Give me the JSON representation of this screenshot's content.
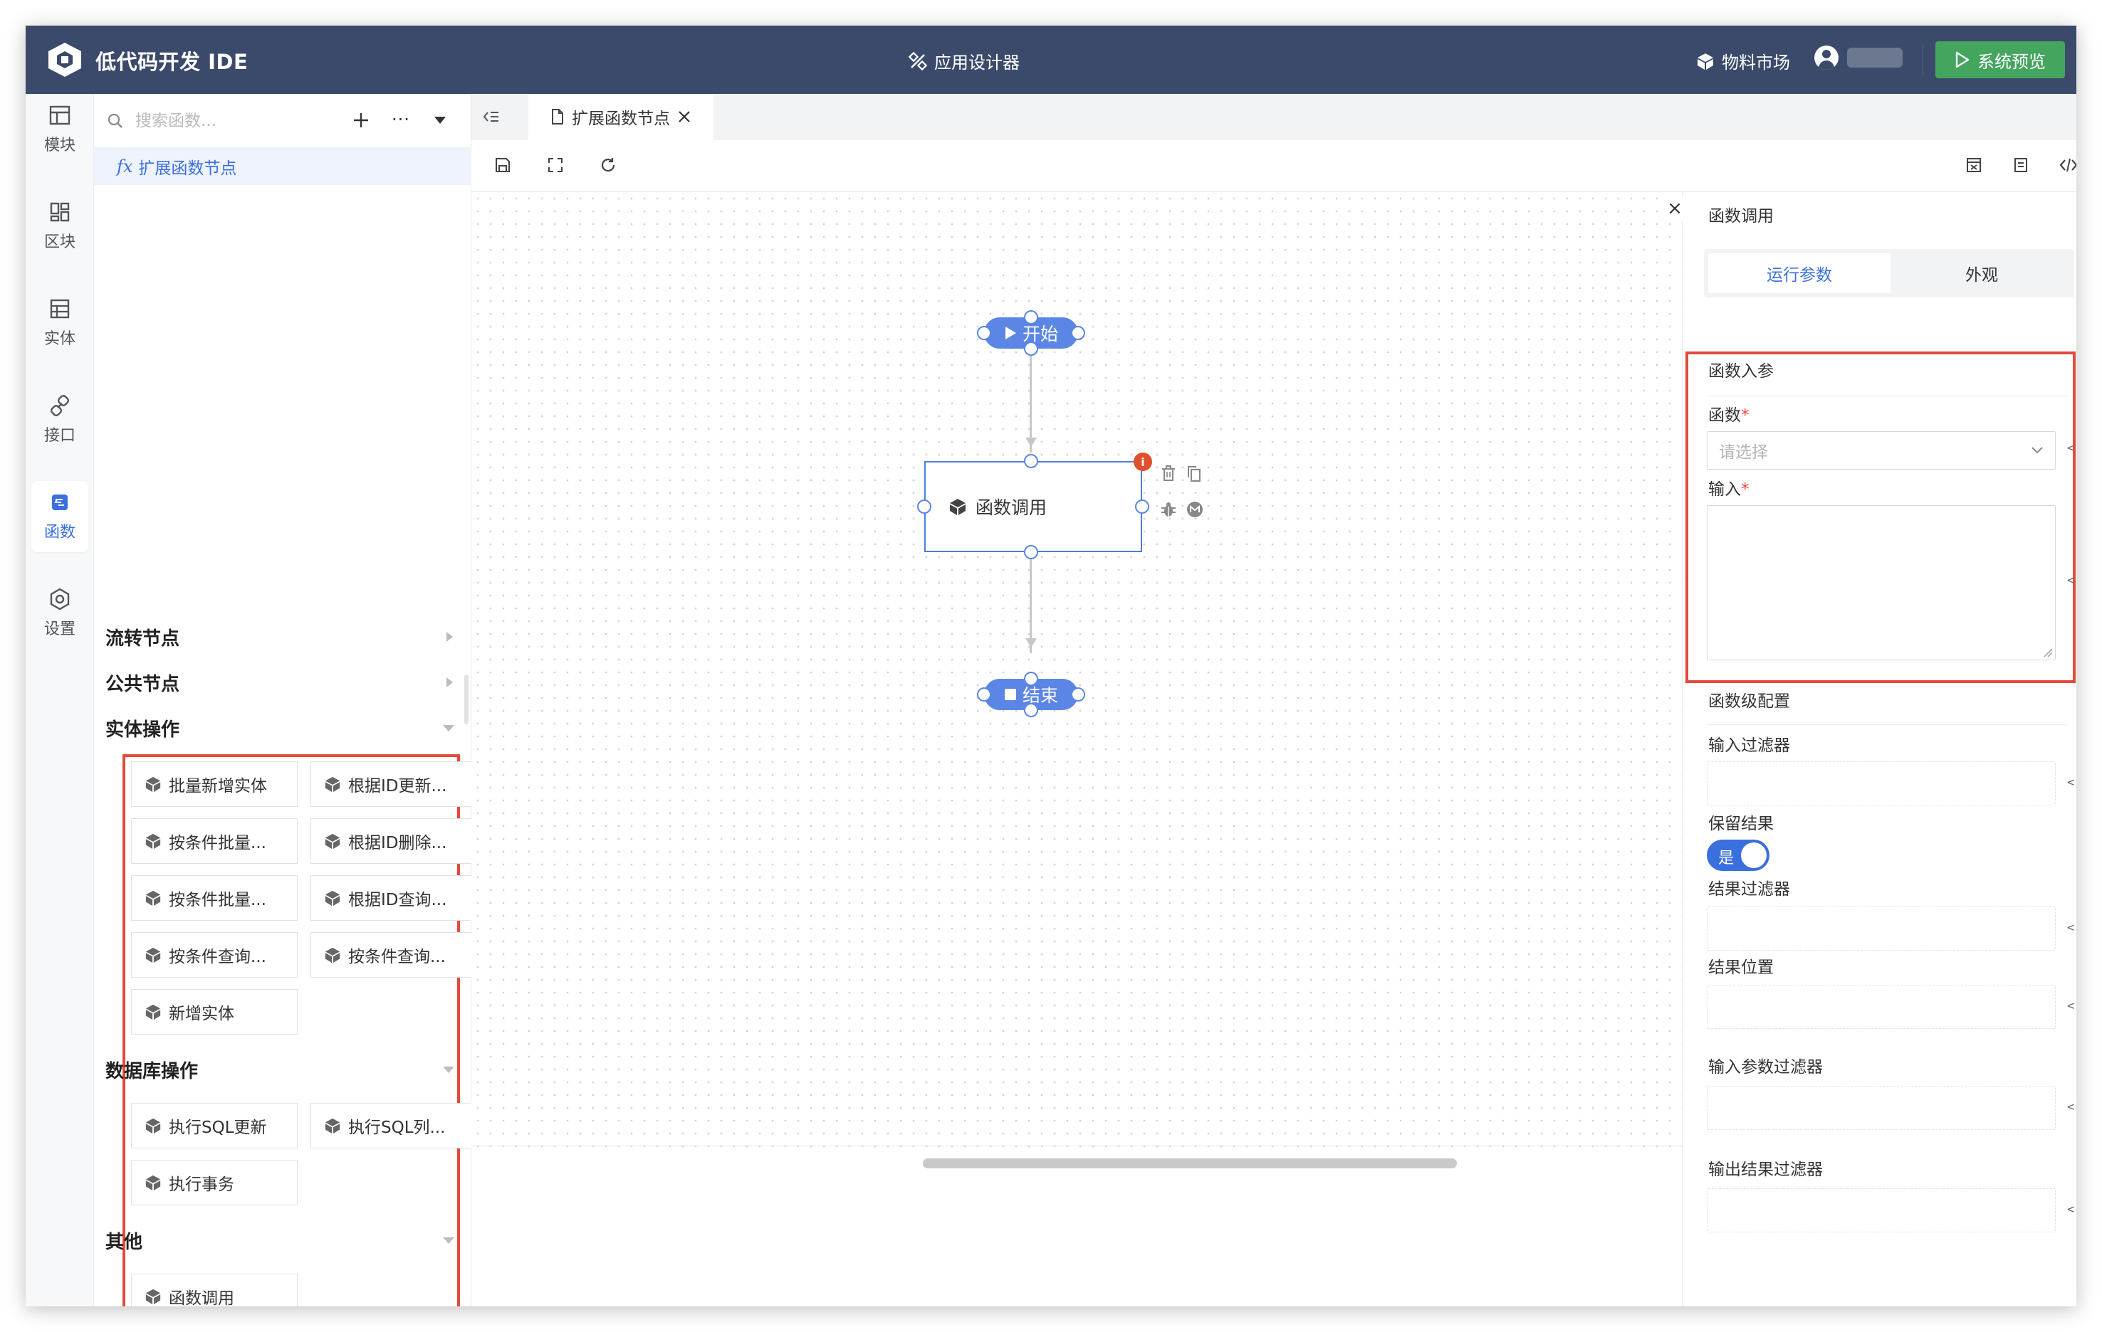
{
  "header": {
    "app_title": "低代码开发 IDE",
    "center_title": "应用设计器",
    "market": "物料市场",
    "preview": "系统预览"
  },
  "nav": {
    "items": [
      {
        "label": "模块",
        "icon": "layout-icon"
      },
      {
        "label": "区块",
        "icon": "blocks-icon"
      },
      {
        "label": "实体",
        "icon": "table-icon"
      },
      {
        "label": "接口",
        "icon": "link-icon"
      },
      {
        "label": "函数",
        "icon": "function-icon"
      },
      {
        "label": "设置",
        "icon": "gear-icon"
      }
    ],
    "active": "函数"
  },
  "sidepanel": {
    "search_placeholder": "搜索函数...",
    "more": "···",
    "tree_item": "扩展函数节点",
    "fx_symbol": "fx",
    "groups": [
      {
        "title": "流转节点",
        "collapsed": true
      },
      {
        "title": "公共节点",
        "collapsed": true
      },
      {
        "title": "实体操作",
        "collapsed": false,
        "items": [
          "批量新增实体",
          "根据ID更新...",
          "按条件批量...",
          "根据ID删除...",
          "按条件批量...",
          "根据ID查询...",
          "按条件查询...",
          "按条件查询...",
          "新增实体"
        ]
      },
      {
        "title": "数据库操作",
        "collapsed": false,
        "items": [
          "执行SQL更新",
          "执行SQL列...",
          "执行事务"
        ]
      },
      {
        "title": "其他",
        "collapsed": false,
        "items": [
          "函数调用"
        ]
      }
    ]
  },
  "tabs": [
    {
      "label": "扩展函数节点",
      "active": true
    }
  ],
  "canvas": {
    "start": "开始",
    "node": "函数调用",
    "end": "结束",
    "badge": "i"
  },
  "rightpanel": {
    "title": "函数调用",
    "close": "×",
    "tabs": [
      "运行参数",
      "外观"
    ],
    "active_tab": "运行参数",
    "section1": "函数入参",
    "func_label": "函数",
    "func_placeholder": "请选择",
    "input_label": "输入",
    "required_mark": "*",
    "section2": "函数级配置",
    "input_filter": "输入过滤器",
    "keep_result": "保留结果",
    "keep_result_value": "是",
    "result_filter": "结果过滤器",
    "result_position": "结果位置",
    "input_param_filter": "输入参数过滤器",
    "output_result_filter": "输出结果过滤器",
    "code_toggle": "<·>"
  },
  "colors": {
    "header_bg": "#3b4a6b",
    "accent": "#3a6fde",
    "preview_btn": "#44a55f",
    "highlight": "#e24a3b"
  }
}
